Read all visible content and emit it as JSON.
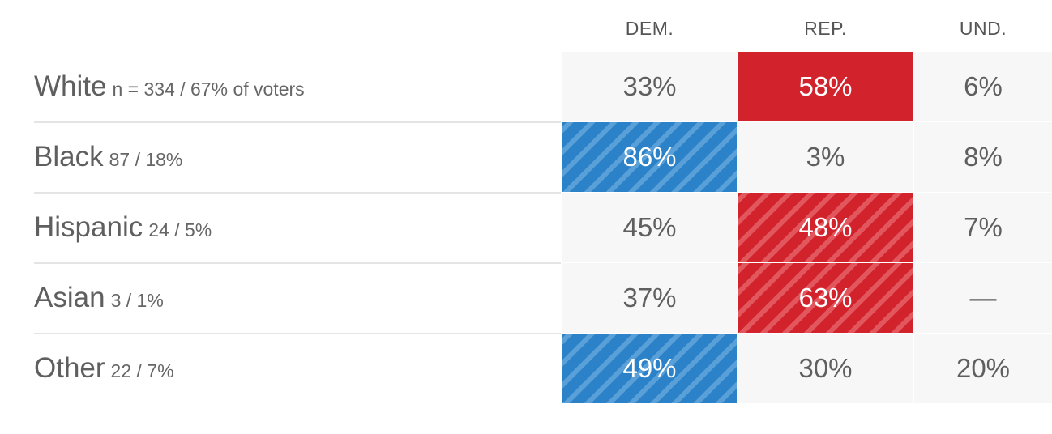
{
  "colors": {
    "dem": "#2b82c8",
    "rep": "#d2232d",
    "neutral_cell": "#f7f7f7",
    "text": "#5f5f5f"
  },
  "headers": [
    "DEM.",
    "REP.",
    "UND."
  ],
  "rows": [
    {
      "group": "White",
      "meta": "n = 334 / 67% of voters",
      "cells": [
        {
          "text": "33%",
          "style": "plain"
        },
        {
          "text": "58%",
          "style": "rep-solid"
        },
        {
          "text": "6%",
          "style": "plain"
        }
      ]
    },
    {
      "group": "Black",
      "meta": "87 / 18%",
      "cells": [
        {
          "text": "86%",
          "style": "dem-hatch"
        },
        {
          "text": "3%",
          "style": "plain"
        },
        {
          "text": "8%",
          "style": "plain"
        }
      ]
    },
    {
      "group": "Hispanic",
      "meta": "24 / 5%",
      "cells": [
        {
          "text": "45%",
          "style": "plain"
        },
        {
          "text": "48%",
          "style": "rep-hatch"
        },
        {
          "text": "7%",
          "style": "plain"
        }
      ]
    },
    {
      "group": "Asian",
      "meta": "3 / 1%",
      "cells": [
        {
          "text": "37%",
          "style": "plain"
        },
        {
          "text": "63%",
          "style": "rep-hatch"
        },
        {
          "text": "—",
          "style": "plain"
        }
      ]
    },
    {
      "group": "Other",
      "meta": "22 / 7%",
      "cells": [
        {
          "text": "49%",
          "style": "dem-hatch"
        },
        {
          "text": "30%",
          "style": "plain"
        },
        {
          "text": "20%",
          "style": "plain"
        }
      ]
    }
  ],
  "chart_data": {
    "type": "table",
    "columns": [
      "DEM.",
      "REP.",
      "UND."
    ],
    "rows": [
      {
        "label": "White",
        "sub": "n = 334 / 67% of voters",
        "values": [
          "33%",
          "58%",
          "6%"
        ]
      },
      {
        "label": "Black",
        "sub": "87 / 18%",
        "values": [
          "86%",
          "3%",
          "8%"
        ]
      },
      {
        "label": "Hispanic",
        "sub": "24 / 5%",
        "values": [
          "45%",
          "48%",
          "7%"
        ]
      },
      {
        "label": "Asian",
        "sub": "3 / 1%",
        "values": [
          "37%",
          "63%",
          "—"
        ]
      },
      {
        "label": "Other",
        "sub": "22 / 7%",
        "values": [
          "49%",
          "30%",
          "20%"
        ]
      }
    ]
  }
}
